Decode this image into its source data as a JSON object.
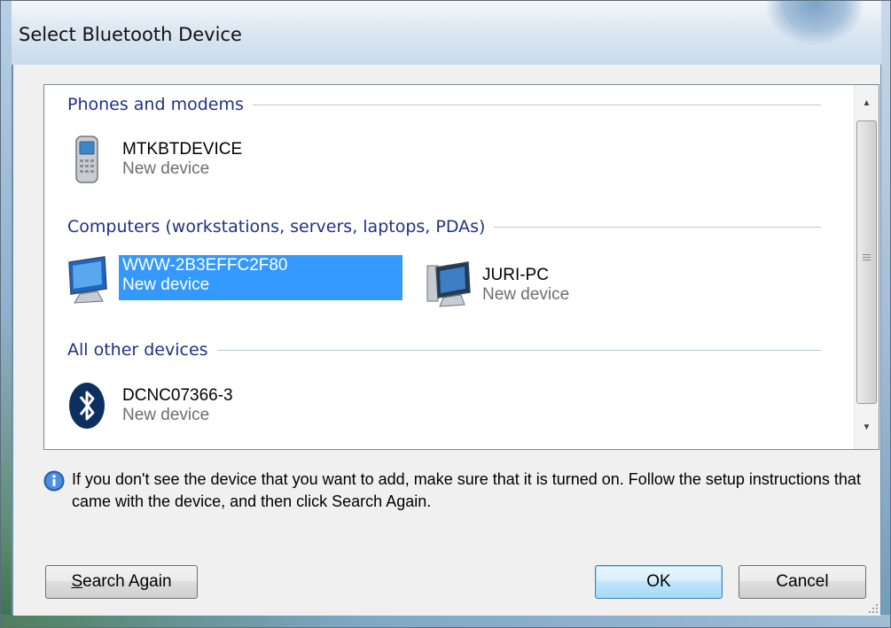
{
  "window": {
    "title": "Select Bluetooth Device"
  },
  "groups": [
    {
      "label": "Phones and modems",
      "devices": [
        {
          "name": "MTKBTDEVICE",
          "status": "New device",
          "icon": "phone-icon"
        }
      ]
    },
    {
      "label": "Computers (workstations, servers, laptops, PDAs)",
      "devices": [
        {
          "name": "WWW-2B3EFFC2F80",
          "status": "New device",
          "icon": "computer-icon",
          "selected": true
        },
        {
          "name": "JURI-PC",
          "status": "New device",
          "icon": "computer-icon"
        }
      ]
    },
    {
      "label": "All other devices",
      "devices": [
        {
          "name": "DCNC07366-3",
          "status": "New device",
          "icon": "bluetooth-icon"
        }
      ]
    }
  ],
  "info": {
    "icon": "info-icon",
    "text": "If you don't see the device that you want to add, make sure that it is turned on. Follow the setup instructions that came with the device, and then click Search Again."
  },
  "buttons": {
    "search_again_accel": "S",
    "search_again_rest": "earch Again",
    "ok": "OK",
    "cancel": "Cancel"
  },
  "colors": {
    "group_header": "#1e3287",
    "selection": "#3399ff",
    "status_text": "#6d6d6d"
  }
}
